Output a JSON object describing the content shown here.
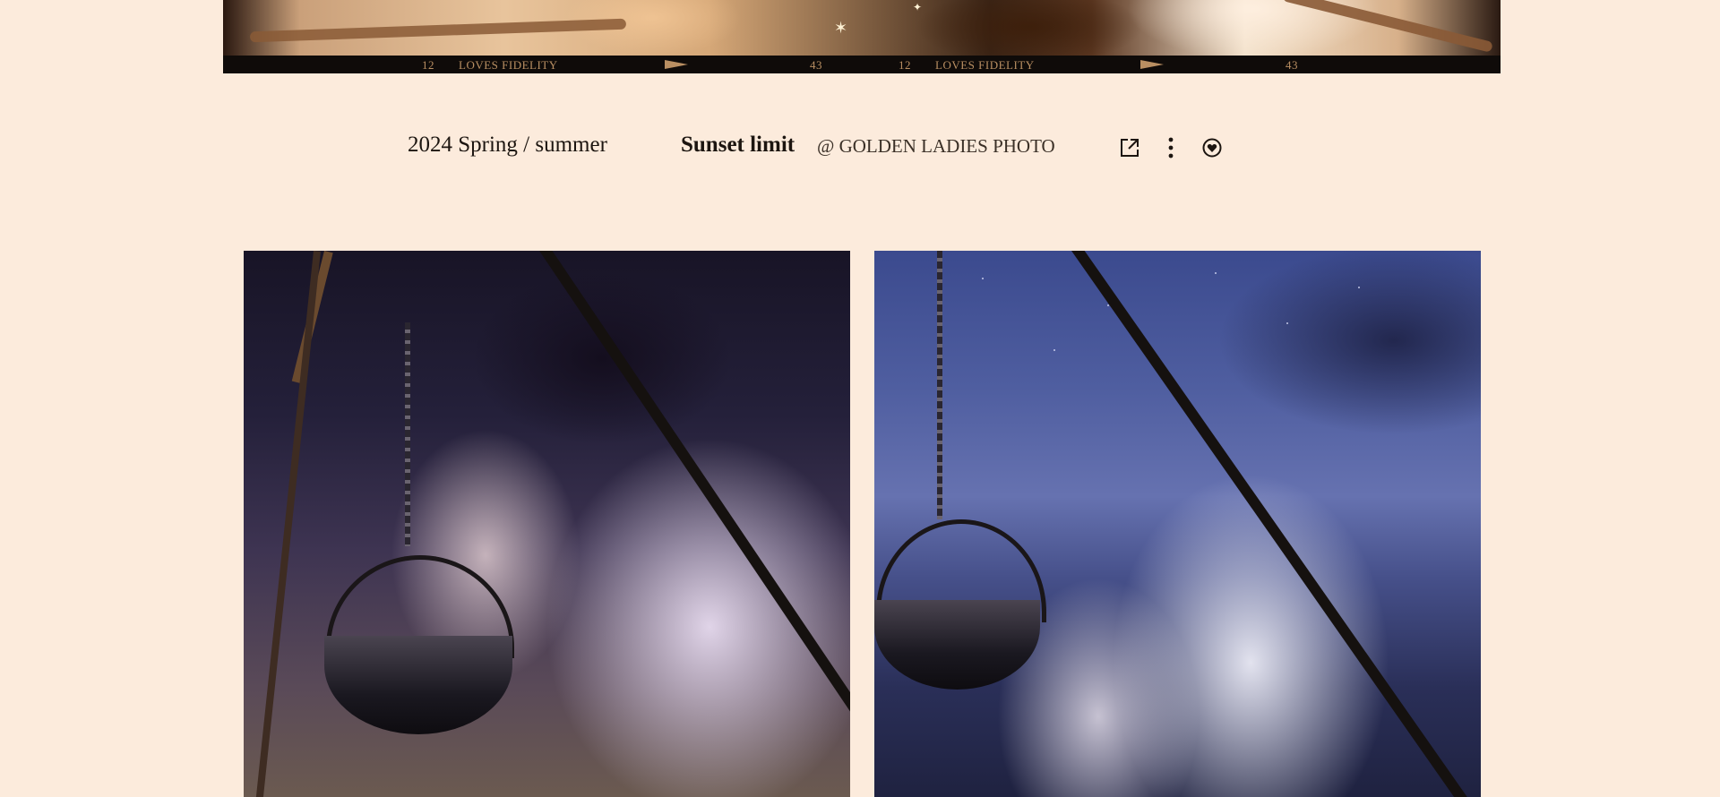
{
  "hero": {
    "film_strip": {
      "frame_left": "12",
      "caption_left": "LOVES FIDELITY",
      "number_mid": "43",
      "frame_right": "12",
      "caption_right": "LOVES FIDELITY",
      "number_right": "43"
    }
  },
  "title_bar": {
    "season": "2024 Spring / summer",
    "collection_title": "Sunset limit",
    "credit": "@ GOLDEN LADIES PHOTO",
    "actions": {
      "share_icon": "share-external-icon",
      "more_icon": "more-vertical-icon",
      "like_icon": "heart-circle-icon"
    }
  },
  "gallery": {
    "photos": [
      {
        "description_icon": "photo-couple-campfire-dusk"
      },
      {
        "description_icon": "photo-couple-campfire-night-sky"
      }
    ]
  },
  "colors": {
    "page_background": "#fcebdc",
    "text": "#1c1510",
    "film_text": "#b98f62"
  }
}
